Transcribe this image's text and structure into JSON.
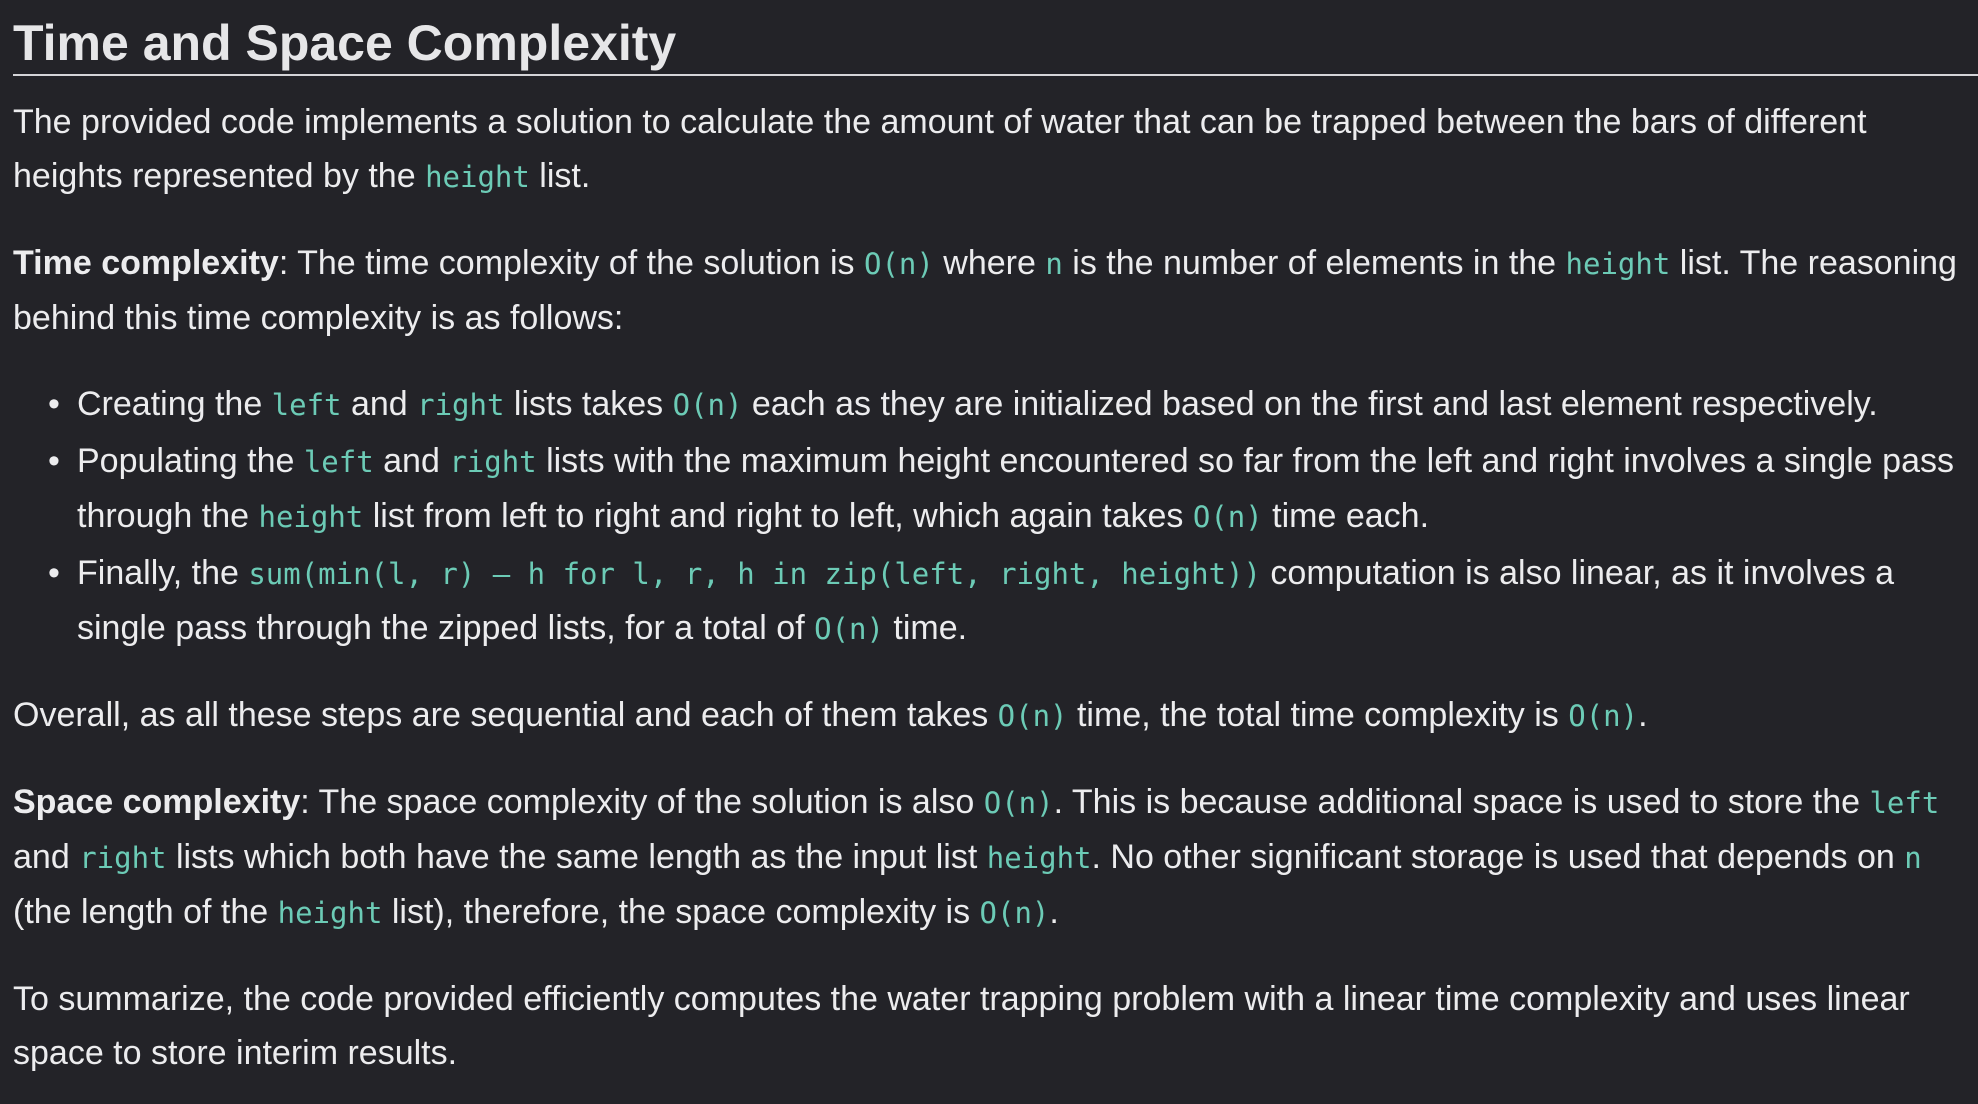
{
  "heading": "Time and Space Complexity",
  "intro": {
    "t1": "The provided code implements a solution to calculate the amount of water that can be trapped between the bars of different heights represented by the ",
    "c1": "height",
    "t2": " list."
  },
  "time": {
    "label": "Time complexity",
    "t1": ": The time complexity of the solution is ",
    "c1": "O(n)",
    "t2": " where ",
    "c2": "n",
    "t3": " is the number of elements in the ",
    "c3": "height",
    "t4": " list. The reasoning behind this time complexity is as follows:"
  },
  "bullets": {
    "b1": {
      "t1": "Creating the ",
      "c1": "left",
      "t2": " and ",
      "c2": "right",
      "t3": " lists takes ",
      "c3": "O(n)",
      "t4": " each as they are initialized based on the first and last element respectively."
    },
    "b2": {
      "t1": "Populating the ",
      "c1": "left",
      "t2": " and ",
      "c2": "right",
      "t3": " lists with the maximum height encountered so far from the left and right involves a single pass through the ",
      "c3": "height",
      "t4": " list from left to right and right to left, which again takes ",
      "c4": "O(n)",
      "t5": " time each."
    },
    "b3": {
      "t1": "Finally, the ",
      "c1": "sum(min(l, r) – h for l, r, h in zip(left, right, height))",
      "t2": " computation is also linear, as it involves a single pass through the zipped lists, for a total of ",
      "c2": "O(n)",
      "t3": " time."
    }
  },
  "overall": {
    "t1": "Overall, as all these steps are sequential and each of them takes ",
    "c1": "O(n)",
    "t2": " time, the total time complexity is ",
    "c2": "O(n)",
    "t3": "."
  },
  "space": {
    "label": "Space complexity",
    "t1": ": The space complexity of the solution is also ",
    "c1": "O(n)",
    "t2": ". This is because additional space is used to store the ",
    "c2": "left",
    "t3": " and ",
    "c3": "right",
    "t4": " lists which both have the same length as the input list ",
    "c4": "height",
    "t5": ". No other significant storage is used that depends on ",
    "c5": "n",
    "t6": " (the length of the ",
    "c6": "height",
    "t7": " list), therefore, the space complexity is ",
    "c7": "O(n)",
    "t8": "."
  },
  "summary": {
    "t1": "To summarize, the code provided efficiently computes the water trapping problem with a linear time complexity and uses linear space to store interim results."
  },
  "bullet_glyph": "•",
  "colors": {
    "background": "#232328",
    "text": "#ececee",
    "code": "#6ccbb6",
    "rule": "#d4d4d8"
  }
}
